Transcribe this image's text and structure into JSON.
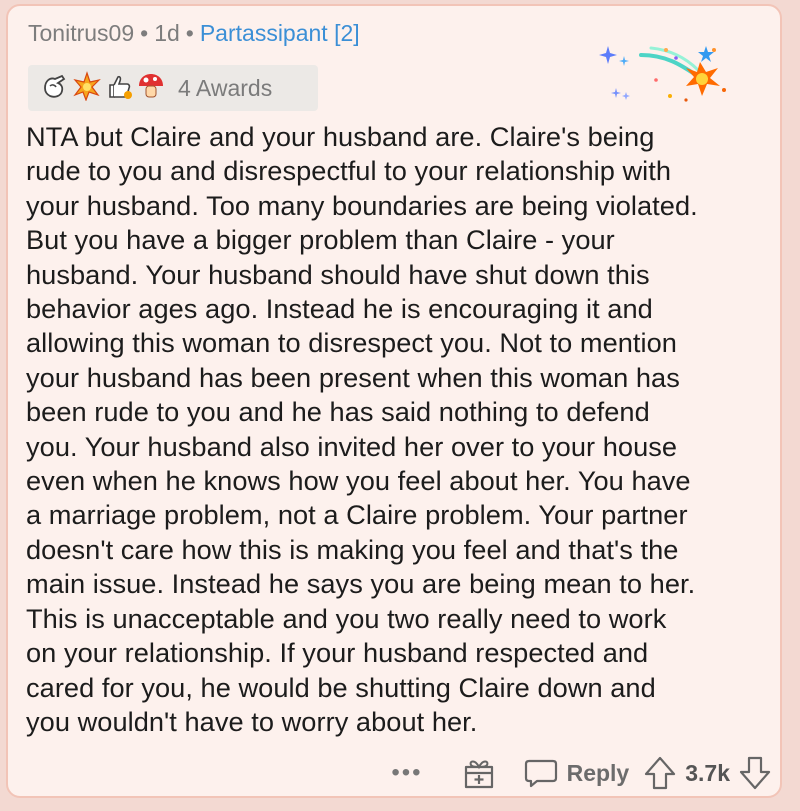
{
  "comment": {
    "author": "Tonitrus09",
    "age": "1d",
    "flair": "Partassipant [2]",
    "separator": "•",
    "awards_count_label": "4 Awards",
    "award_icons": [
      "hand-gesture-award-icon",
      "star-burst-award-icon",
      "thumbs-up-award-icon",
      "mushroom-award-icon"
    ],
    "body_lines": [
      "NTA but Claire and your husband are. Claire's being",
      "rude to you and disrespectful to your relationship with",
      "your husband. Too many boundaries are being violated.",
      "But you have a bigger problem than Claire - your",
      "husband. Your husband should have shut down this",
      "behavior ages ago. Instead he is encouraging it and",
      "allowing this woman to disrespect you. Not to mention",
      "your husband has been present when this woman has",
      "been rude to you and he has said nothing to defend",
      "you. Your husband also invited her over to your house",
      "even when he knows how you feel about her. You have",
      "a marriage problem, not a Claire problem. Your partner",
      "doesn't care how this is making you feel and that's the",
      "main issue. Instead he says you are being mean to her.",
      "This is unacceptable and you two really need to work",
      "on your relationship. If your husband respected and",
      "cared for you, he would be shutting Claire down and",
      "you wouldn't have to worry about her."
    ]
  },
  "footer": {
    "more_label": "•••",
    "reply_label": "Reply",
    "score": "3.7k"
  },
  "colors": {
    "background": "#f3d9d2",
    "card": "#fdf1ed",
    "flair": "#3b8fd6",
    "meta_text": "#7d7d7d",
    "body_text": "#1c1c1c"
  }
}
